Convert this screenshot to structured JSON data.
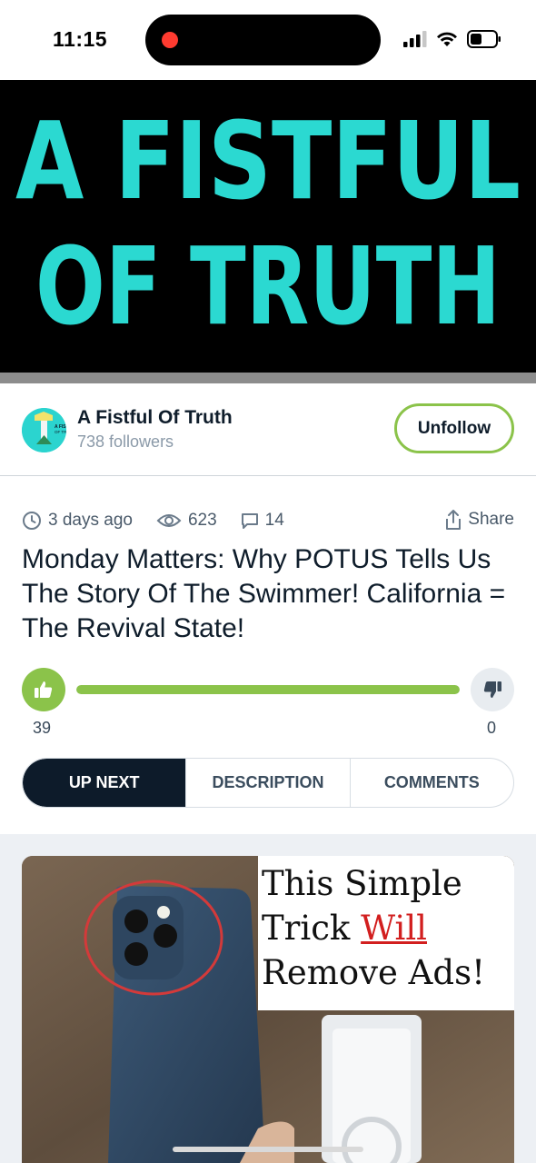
{
  "status_bar": {
    "time": "11:15"
  },
  "banner": {
    "line1": "A FISTFUL",
    "line2": "OF TRUTH",
    "accent": "#2bd9d1"
  },
  "channel": {
    "name": "A Fistful Of Truth",
    "followers": "738 followers",
    "unfollow_label": "Unfollow",
    "avatar_text": "A FISTFUL OF TRUTH"
  },
  "meta": {
    "age": "3 days ago",
    "views": "623",
    "comments": "14",
    "share_label": "Share"
  },
  "video": {
    "title": "Monday Matters: Why POTUS Tells Us The Story Of The Swimmer! California = The Revival State!"
  },
  "votes": {
    "likes": "39",
    "dislikes": "0",
    "like_fraction": 1.0
  },
  "tabs": [
    {
      "label": "UP NEXT",
      "active": true
    },
    {
      "label": "DESCRIPTION",
      "active": false
    },
    {
      "label": "COMMENTS",
      "active": false
    }
  ],
  "up_next": {
    "line1": "This Simple",
    "line2a": "Trick ",
    "line2b": "Will",
    "line3": "Remove Ads!"
  },
  "colors": {
    "brand_green": "#8bc34a",
    "dark": "#0d1b2a",
    "banner_teal": "#2bd9d1"
  }
}
